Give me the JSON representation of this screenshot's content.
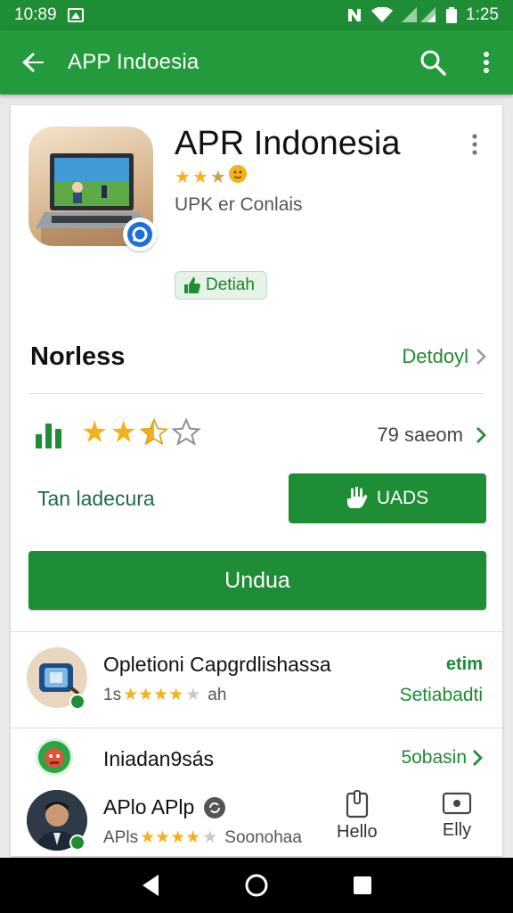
{
  "status_bar": {
    "time_left": "10:89",
    "time_right": "1:25"
  },
  "app_bar": {
    "title": "APP Indoesia"
  },
  "app": {
    "name": "APR Indonesia",
    "developer": "UPK er Conlais",
    "chip_label": "Detiah"
  },
  "section": {
    "heading": "Norless",
    "link": "Detdoyl"
  },
  "rating": {
    "stars_value": 3.5,
    "stars_max": 5,
    "reviews_link": "79 saeom"
  },
  "size": {
    "label": "Tan ladecura"
  },
  "buttons": {
    "uads": "UADS",
    "install": "Undua"
  },
  "list": [
    {
      "title": "Opletioni Capgrdlishassa",
      "sub_prefix": "1s",
      "sub_suffix": "ah",
      "right": "etim",
      "right2": "Setiabadti"
    },
    {
      "title": "Iniadan9sás",
      "right": "5obasin"
    },
    {
      "title": "APlo APlp",
      "sub_prefix": "APls",
      "sub_suffix": "Soonohaa"
    }
  ],
  "bottom_actions": [
    {
      "label": "Hello"
    },
    {
      "label": "Elly"
    }
  ],
  "colors": {
    "primary": "#1f8d35",
    "appbar": "#239a3b",
    "star": "#f3b21b"
  }
}
